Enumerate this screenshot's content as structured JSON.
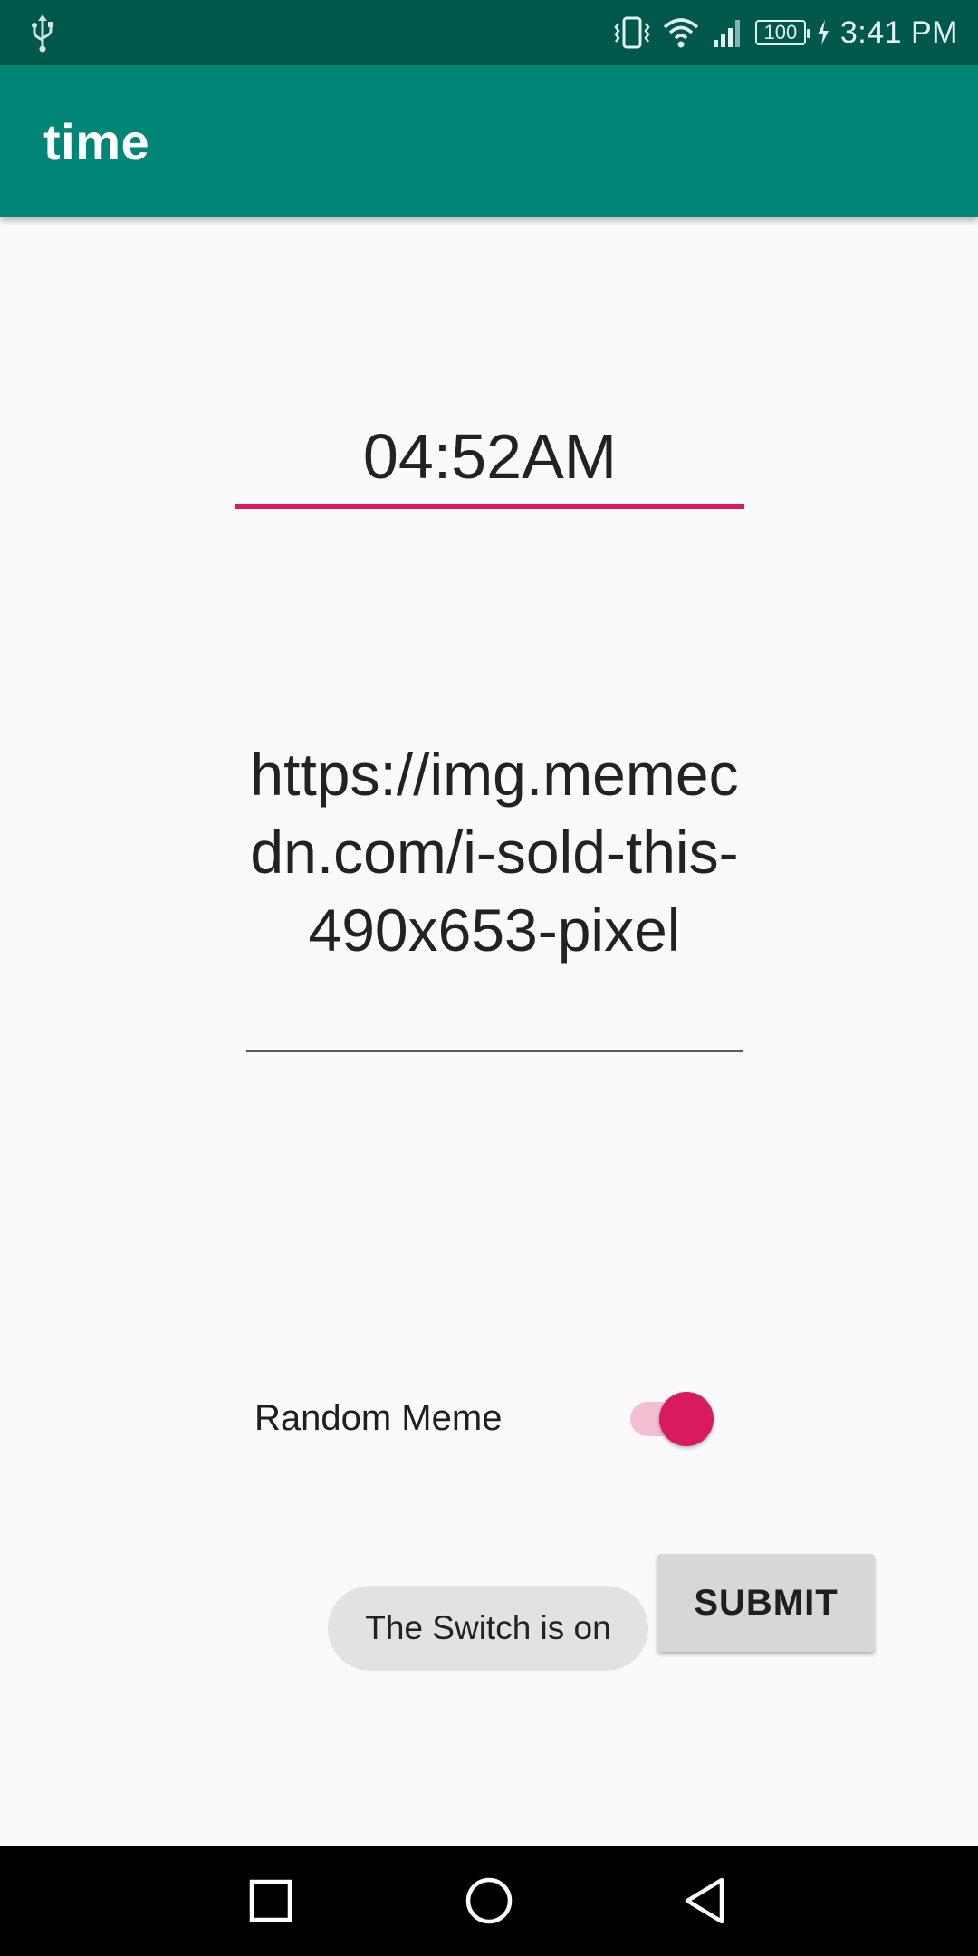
{
  "status_bar": {
    "time": "3:41 PM",
    "battery": "100",
    "icons": [
      "usb-icon",
      "vibrate-icon",
      "wifi-icon",
      "signal-icon",
      "battery-icon",
      "charging-icon"
    ]
  },
  "app_bar": {
    "title": "time"
  },
  "time_field": {
    "value": "04:52AM"
  },
  "url_field": {
    "value": "https://img.memecdn.com/i-sold-this-490x653-pixel"
  },
  "switch": {
    "label": "Random Meme",
    "checked": true
  },
  "toast": {
    "text": "The Switch is on"
  },
  "submit_button": {
    "label": "SUBMIT"
  },
  "nav_bar": {
    "buttons": [
      "recents-icon",
      "home-icon",
      "back-icon"
    ]
  },
  "colors": {
    "status_bar": "#00574b",
    "app_bar": "#008577",
    "accent": "#d81b60",
    "switch_track": "#f3bed1",
    "background": "#fafafa"
  }
}
